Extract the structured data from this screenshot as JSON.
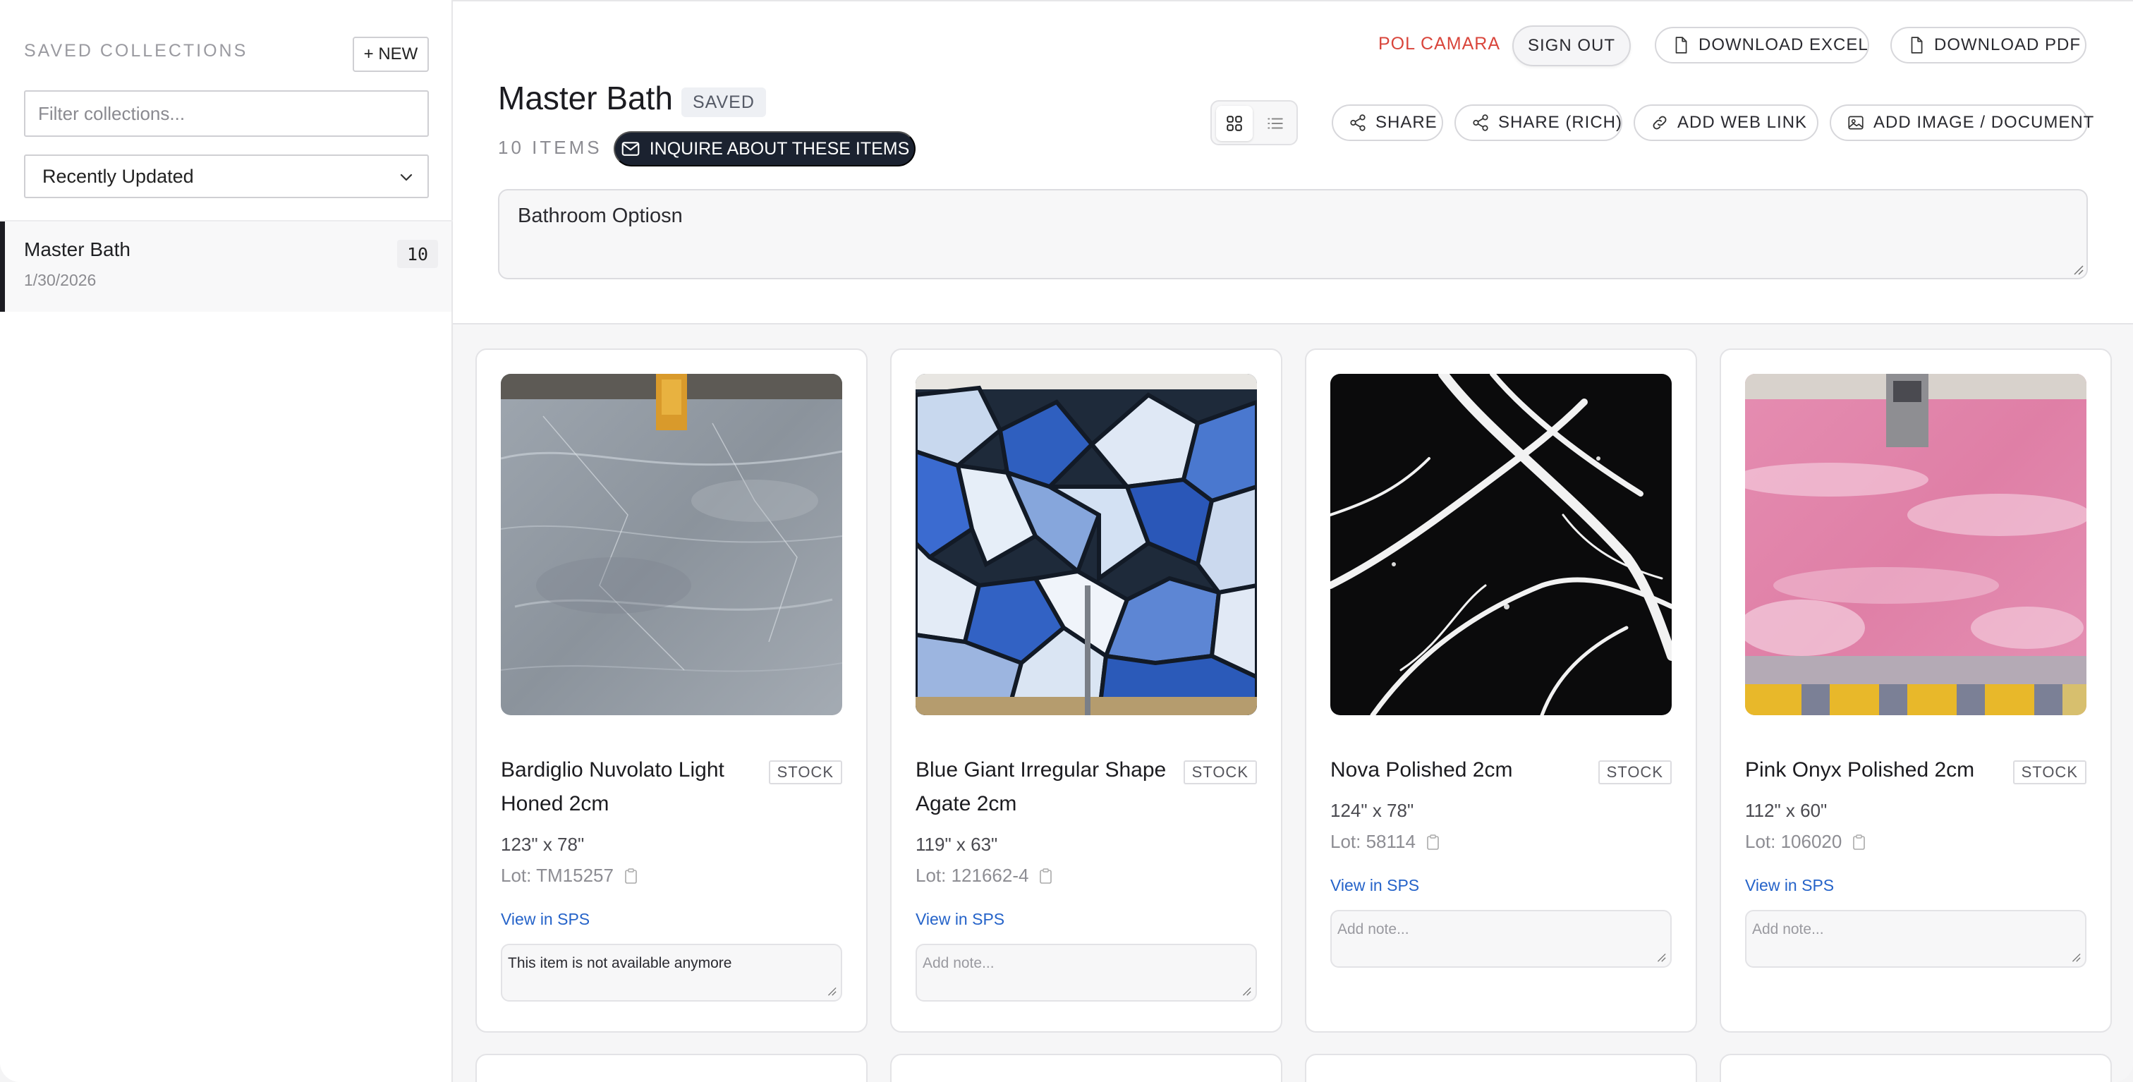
{
  "sidebar": {
    "title": "SAVED COLLECTIONS",
    "new_label": "+ NEW",
    "filter_placeholder": "Filter collections...",
    "sort_value": "Recently Updated",
    "collections": [
      {
        "name": "Master Bath",
        "date": "1/30/2026",
        "count": "10"
      }
    ]
  },
  "header": {
    "user_name": "POL CAMARA",
    "sign_out": "SIGN OUT",
    "download_excel": "DOWNLOAD EXCEL",
    "download_pdf": "DOWNLOAD PDF",
    "share": "SHARE",
    "share_rich": "SHARE (RICH)",
    "add_web_link": "ADD WEB LINK",
    "add_image_document": "ADD IMAGE / DOCUMENT",
    "title": "Master Bath",
    "saved_badge": "SAVED",
    "items_count": "10 ITEMS",
    "inquire_label": "INQUIRE ABOUT THESE ITEMS",
    "description": "Bathroom Optiosn"
  },
  "items": [
    {
      "name": "Bardiglio Nuvolato Light Honed 2cm",
      "badge": "STOCK",
      "dims": "123\" x 78\"",
      "lot": "Lot: TM15257",
      "link": "View in SPS",
      "note": "This item is not available anymore",
      "note_placeholder": "Add note...",
      "image": "grey-marble-slab"
    },
    {
      "name": "Blue Giant Irregular Shape Agate 2cm",
      "badge": "STOCK",
      "dims": "119\" x 63\"",
      "lot": "Lot: 121662-4",
      "link": "View in SPS",
      "note": "",
      "note_placeholder": "Add note...",
      "image": "blue-agate-slab"
    },
    {
      "name": "Nova Polished 2cm",
      "badge": "STOCK",
      "dims": "124\" x 78\"",
      "lot": "Lot: 58114",
      "link": "View in SPS",
      "note": "",
      "note_placeholder": "Add note...",
      "image": "black-white-marble-slab"
    },
    {
      "name": "Pink Onyx Polished 2cm",
      "badge": "STOCK",
      "dims": "112\" x 60\"",
      "lot": "Lot: 106020",
      "link": "View in SPS",
      "note": "",
      "note_placeholder": "Add note...",
      "image": "pink-onyx-slab"
    }
  ],
  "colors": {
    "accent_dark": "#1b2230",
    "user_red": "#d9453b",
    "link_blue": "#2563c9"
  }
}
